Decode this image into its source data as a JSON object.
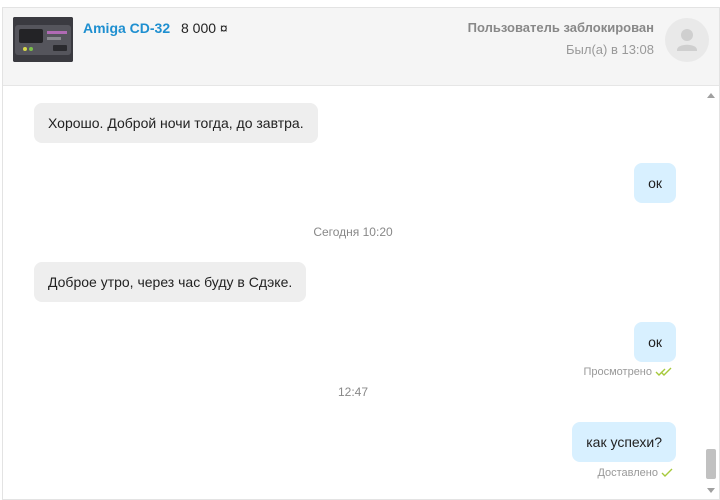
{
  "header": {
    "item_title": "Amiga CD-32",
    "item_price": "8 000 ¤",
    "user_status": "Пользователь заблокирован",
    "last_seen": "Был(а) в 13:08"
  },
  "messages": [
    {
      "type": "in",
      "text": "Хорошо. Доброй ночи тогда, до завтра."
    },
    {
      "type": "out",
      "text": "ок"
    },
    {
      "type": "date",
      "text": "Сегодня 10:20"
    },
    {
      "type": "in",
      "text": "Доброе утро, через час буду в Сдэке."
    },
    {
      "type": "out",
      "text": "ок",
      "status": "Просмотрено"
    },
    {
      "type": "date",
      "text": "12:47"
    },
    {
      "type": "out",
      "text": "как успехи?",
      "status": "Доставлено"
    }
  ],
  "colors": {
    "accent": "#1e8fd0",
    "read_check": "#a6c93b",
    "incoming_bubble": "#eeeeee",
    "outgoing_bubble": "#d8f0ff"
  },
  "icons": {
    "read": "double-check-icon",
    "delivered": "check-icon",
    "avatar": "user-silhouette-icon"
  }
}
